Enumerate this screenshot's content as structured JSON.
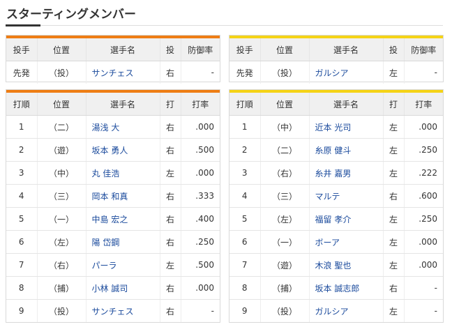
{
  "title": "スターティングメンバー",
  "colors": {
    "home_accent": "#ee7d14",
    "away_accent": "#f5d316",
    "link": "#1a4a9c"
  },
  "pitcher_headers": [
    "投手",
    "位置",
    "選手名",
    "投",
    "防御率"
  ],
  "lineup_headers": [
    "打順",
    "位置",
    "選手名",
    "打",
    "打率"
  ],
  "home": {
    "pitcher": {
      "role": "先発",
      "pos": "（投）",
      "name": "サンチェス",
      "throws": "右",
      "era": "-"
    },
    "lineup": [
      {
        "order": "1",
        "pos": "（二）",
        "name": "湯浅 大",
        "bats": "右",
        "avg": ".000"
      },
      {
        "order": "2",
        "pos": "（遊）",
        "name": "坂本 勇人",
        "bats": "右",
        "avg": ".500"
      },
      {
        "order": "3",
        "pos": "（中）",
        "name": "丸 佳浩",
        "bats": "左",
        "avg": ".000"
      },
      {
        "order": "4",
        "pos": "（三）",
        "name": "岡本 和真",
        "bats": "右",
        "avg": ".333"
      },
      {
        "order": "5",
        "pos": "（一）",
        "name": "中島 宏之",
        "bats": "右",
        "avg": ".400"
      },
      {
        "order": "6",
        "pos": "（左）",
        "name": "陽 岱鋼",
        "bats": "右",
        "avg": ".250"
      },
      {
        "order": "7",
        "pos": "（右）",
        "name": "パーラ",
        "bats": "左",
        "avg": ".500"
      },
      {
        "order": "8",
        "pos": "（捕）",
        "name": "小林 誠司",
        "bats": "右",
        "avg": ".000"
      },
      {
        "order": "9",
        "pos": "（投）",
        "name": "サンチェス",
        "bats": "右",
        "avg": "-"
      }
    ]
  },
  "away": {
    "pitcher": {
      "role": "先発",
      "pos": "（投）",
      "name": "ガルシア",
      "throws": "左",
      "era": "-"
    },
    "lineup": [
      {
        "order": "1",
        "pos": "（中）",
        "name": "近本 光司",
        "bats": "左",
        "avg": ".000"
      },
      {
        "order": "2",
        "pos": "（二）",
        "name": "糸原 健斗",
        "bats": "左",
        "avg": ".250"
      },
      {
        "order": "3",
        "pos": "（右）",
        "name": "糸井 嘉男",
        "bats": "左",
        "avg": ".222"
      },
      {
        "order": "4",
        "pos": "（三）",
        "name": "マルテ",
        "bats": "右",
        "avg": ".600"
      },
      {
        "order": "5",
        "pos": "（左）",
        "name": "福留 孝介",
        "bats": "左",
        "avg": ".250"
      },
      {
        "order": "6",
        "pos": "（一）",
        "name": "ボーア",
        "bats": "左",
        "avg": ".000"
      },
      {
        "order": "7",
        "pos": "（遊）",
        "name": "木浪 聖也",
        "bats": "左",
        "avg": ".000"
      },
      {
        "order": "8",
        "pos": "（捕）",
        "name": "坂本 誠志郎",
        "bats": "右",
        "avg": "-"
      },
      {
        "order": "9",
        "pos": "（投）",
        "name": "ガルシア",
        "bats": "左",
        "avg": "-"
      }
    ]
  }
}
